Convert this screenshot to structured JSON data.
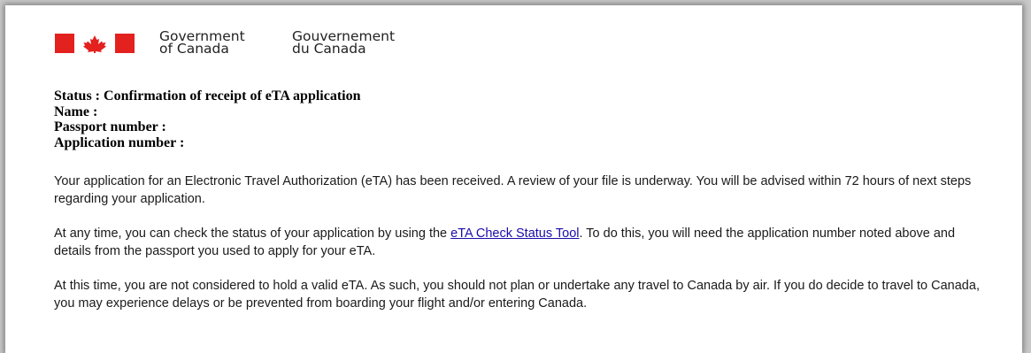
{
  "header": {
    "government_en_line1": "Government",
    "government_en_line2": "of Canada",
    "government_fr_line1": "Gouvernement",
    "government_fr_line2": "du Canada",
    "flag_color": "#e3211f"
  },
  "status": {
    "status_line": "Status : Confirmation of receipt of eTA application",
    "name_label": "Name :",
    "passport_label": "Passport number :",
    "application_label": "Application number :"
  },
  "body": {
    "p1": "Your application for an Electronic Travel Authorization (eTA) has been received. A review of your file is underway. You will be advised within 72 hours of next steps regarding your application.",
    "p2_before": "At any time, you can check the status of your application by using the ",
    "p2_link": "eTA Check Status Tool",
    "p2_after": ". To do this, you will need the application number noted above and details from the passport you used to apply for your eTA.",
    "p3": "At this time, you are not considered to hold a valid eTA. As such, you should not plan or undertake any travel to Canada by air. If you do decide to travel to Canada, you may experience delays or be prevented from boarding your flight and/or entering Canada.",
    "link_color": "#1a0dab"
  }
}
